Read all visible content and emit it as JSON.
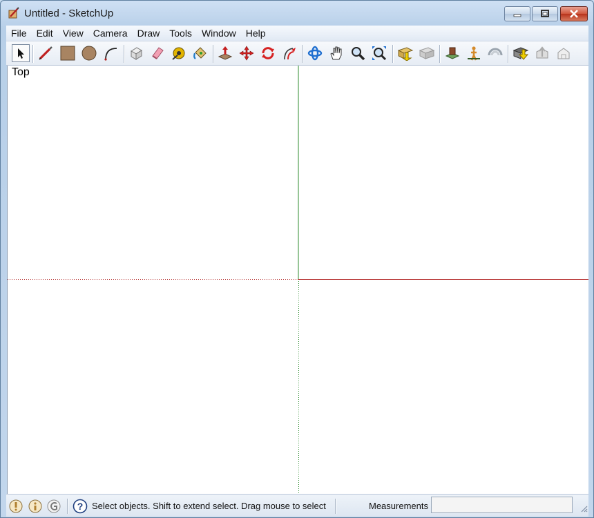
{
  "window": {
    "title": "Untitled - SketchUp",
    "controls": {
      "minimize": "minimize",
      "maximize": "maximize",
      "close": "close"
    }
  },
  "menu": [
    "File",
    "Edit",
    "View",
    "Camera",
    "Draw",
    "Tools",
    "Window",
    "Help"
  ],
  "toolbar": {
    "tools": [
      {
        "name": "select",
        "icon": "arrow-cursor-icon",
        "active": true
      },
      {
        "name": "pencil",
        "icon": "pencil-icon"
      },
      {
        "name": "rectangle",
        "icon": "rectangle-icon"
      },
      {
        "name": "circle",
        "icon": "circle-icon"
      },
      {
        "name": "arc",
        "icon": "arc-icon"
      },
      {
        "name": "make-component",
        "icon": "component-icon"
      },
      {
        "name": "eraser",
        "icon": "eraser-icon"
      },
      {
        "name": "tape-measure",
        "icon": "tape-measure-icon"
      },
      {
        "name": "paint-bucket",
        "icon": "paint-bucket-icon"
      },
      {
        "name": "push-pull",
        "icon": "push-pull-icon"
      },
      {
        "name": "move",
        "icon": "move-icon"
      },
      {
        "name": "rotate",
        "icon": "rotate-icon"
      },
      {
        "name": "offset",
        "icon": "offset-icon"
      },
      {
        "name": "orbit",
        "icon": "orbit-icon"
      },
      {
        "name": "pan",
        "icon": "pan-hand-icon"
      },
      {
        "name": "zoom",
        "icon": "zoom-icon"
      },
      {
        "name": "zoom-extents",
        "icon": "zoom-extents-icon"
      },
      {
        "name": "previous-view",
        "icon": "previous-view-icon"
      },
      {
        "name": "next-view",
        "icon": "next-view-icon"
      },
      {
        "name": "position-camera",
        "icon": "position-camera-icon"
      },
      {
        "name": "walk",
        "icon": "walk-icon"
      },
      {
        "name": "look-around",
        "icon": "look-around-icon"
      },
      {
        "name": "get-models",
        "icon": "get-models-icon"
      },
      {
        "name": "share-model",
        "icon": "share-model-icon"
      },
      {
        "name": "share-component",
        "icon": "share-component-icon"
      }
    ]
  },
  "viewport": {
    "label": "Top",
    "axis_colors": {
      "green": "#2e8b2e",
      "red": "#b01e1e"
    }
  },
  "status": {
    "geo_icons": [
      "geolocation-icon",
      "credits-icon",
      "sign-in-icon"
    ],
    "help_icon": "question-mark-icon",
    "message": "Select objects. Shift to extend select. Drag mouse to select",
    "measurements_label": "Measurements",
    "measurements_value": ""
  }
}
